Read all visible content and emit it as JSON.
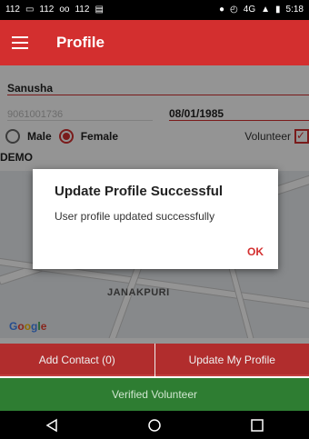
{
  "status_bar": {
    "left_items": [
      "112",
      "112",
      "112"
    ],
    "time": "5:18",
    "network": "4G"
  },
  "app_bar": {
    "title": "Profile"
  },
  "form": {
    "name": "Sanusha",
    "phone": "9061001736",
    "dob": "08/01/1985",
    "gender_options": [
      {
        "label": "Male",
        "selected": false
      },
      {
        "label": "Female",
        "selected": true
      }
    ],
    "volunteer_label": "Volunteer",
    "volunteer_checked": true,
    "demo_text": "DEMO"
  },
  "map": {
    "place_label": "JANAKPURI",
    "attribution": [
      "G",
      "o",
      "o",
      "g",
      "l",
      "e"
    ]
  },
  "dialog": {
    "title": "Update Profile Successful",
    "message": "User profile updated successfully",
    "ok_label": "OK"
  },
  "actions": {
    "add_contact": "Add Contact (0)",
    "update_profile": "Update My Profile"
  },
  "verified_label": "Verified Volunteer",
  "colors": {
    "primary": "#d32f2f",
    "verified": "#2e7d32"
  }
}
